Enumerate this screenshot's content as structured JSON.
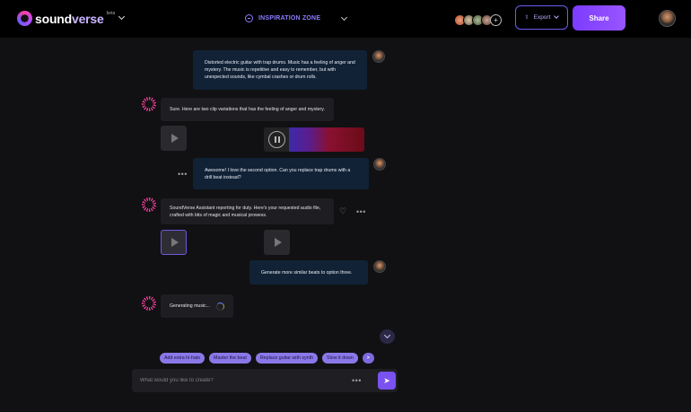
{
  "header": {
    "logo_word_a": "sound",
    "logo_word_b": "verse",
    "logo_badge": "beta",
    "zone_label": "INSPIRATION ZONE",
    "export_label": "Export",
    "share_label": "Share",
    "collaborators": [
      "#d86a4a",
      "#c9b08a",
      "#7a8a6a",
      "#a68d78"
    ],
    "add_collaborator": "+"
  },
  "chat": {
    "msg1": "Distorted electric guitar with trap drums. Music has a feeling of anger and mystery. The music is repetitive and easy to remember, but with unexpected sounds, like cymbal crashes or drum rolls.",
    "reply1": "Sure. Here are two clip variations that has the feeling of anger and mystery.",
    "msg2": "Awesome! I love the second option. Can you replace trap drums with a drill beat instead?",
    "reply2": "SoundVerse Assistant reporting for duty. Here's your requested audio file, crafted with bits of magic and musical prowess.",
    "msg3": "Generate more similar beats to option three.",
    "reply3": "Generating music...",
    "more_icon": "•••"
  },
  "suggestions": [
    "Add extra hi-hats",
    "Master the beat",
    "Replace guitar with synth",
    "Slow it down"
  ],
  "suggestions_more": ">",
  "composer": {
    "placeholder": "What would you like to create?",
    "send_icon": "➤"
  },
  "colors": {
    "accent": "#7b3cff",
    "user_bubble": "#112236",
    "assistant_bubble": "#1e1e22",
    "chip": "#8a78e8"
  }
}
